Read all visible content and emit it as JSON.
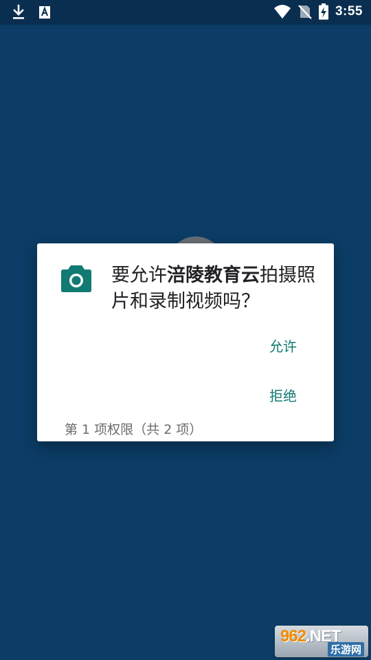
{
  "status_bar": {
    "time": "3:55",
    "left_icons": [
      "download-icon",
      "font-icon"
    ],
    "right_icons": [
      "wifi-icon",
      "no-sim-icon",
      "battery-charging-icon"
    ]
  },
  "dialog": {
    "message_prefix": "要允许",
    "app_name": "涪陵教育云",
    "message_suffix": "拍摄照片和录制视频吗？",
    "allow_label": "允许",
    "deny_label": "拒绝",
    "footer": "第 1 项权限（共 2 项）",
    "icon": "camera-icon",
    "accent_color": "#117a72"
  },
  "watermark": {
    "num": "962",
    "suffix": ".NET",
    "subtitle": "乐游网"
  },
  "colors": {
    "background": "#0b3d66",
    "status_bar": "#0a2e50",
    "dialog_bg": "#ffffff"
  }
}
